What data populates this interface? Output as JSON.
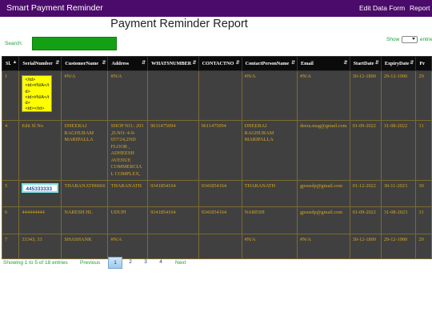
{
  "navbar": {
    "brand": "Smart Payment Reminder",
    "links": [
      "Edit Data Form",
      "Report"
    ]
  },
  "title": "Payment Reminder Report",
  "search": {
    "label": "Search:",
    "value": ""
  },
  "length": {
    "prefix": "Show",
    "suffix": "entries"
  },
  "colors": {
    "navbar": "#4b0b6b",
    "row_bg": "#404040",
    "row_text": "#d8a820",
    "header_bg": "#0b0b0b",
    "accent_green": "#1e9e3a",
    "search_box": "#14a014"
  },
  "table": {
    "headers": [
      "Sl.",
      "SerialNumber",
      "CustomerName",
      "Address",
      "WHATSNUMBER",
      "CONTACTNO",
      "ContactPersonName",
      "Email",
      "StartDate",
      "ExpiryDate",
      "Pr"
    ],
    "rows": [
      {
        "sl": "1",
        "serial_code": "</td>\n<td>#N/A</td>\n<td>#N/A</td>\n<td></td>\n<td></td>",
        "customer": "#N/A",
        "address": "#N/A",
        "whats": "",
        "contact": "",
        "person": "#N/A",
        "email": "#N/A",
        "start": "30-12-1899",
        "expiry": "29-12-1900",
        "pr": "29"
      },
      {
        "sl": "4",
        "serial": "Edit Sl No",
        "customer": "DHEERAJ RAGHURAM MARIPALLA",
        "address": "SHOP NO.: 203 ,D.NO: 4-9-657/24,2ND FLOOR , ADHEESH AVENUE COMMERCIAL COMPLEX,",
        "whats": "9611475094",
        "contact": "9611475094",
        "person": "DHEERAJ RAGHURAM MARIPALLA",
        "email": "deera.mag@gmail.com",
        "start": "01-09-2022",
        "expiry": "31-08-2022",
        "pr": "31"
      },
      {
        "sl": "5",
        "serial_input": "445333333",
        "customer": "THARANATH6666",
        "address": "THARANATH",
        "whats": "9341854164",
        "contact": "9341854164",
        "person": "THARANATH",
        "email": "gpsnsdp@gmail.com",
        "start": "01-12-2022",
        "expiry": "30-11-2023",
        "pr": "30"
      },
      {
        "sl": "6",
        "serial": "444444444",
        "customer": "NARESH HL",
        "address": "UDUPI",
        "whats": "9341854164",
        "contact": "9341854164",
        "person": "NARESH",
        "email": "gpsnsdp@gmail.com",
        "start": "01-09-2022",
        "expiry": "31-08-2023",
        "pr": "31"
      },
      {
        "sl": "7",
        "serial": "33343, 33",
        "customer": "SHASHANK",
        "address": "#N/A",
        "whats": "",
        "contact": "",
        "person": "#N/A",
        "email": "#N/A",
        "start": "30-12-1899",
        "expiry": "29-12-1900",
        "pr": "29"
      }
    ]
  },
  "footer": {
    "info": "Showing 1 to 5 of 18 entries",
    "previous": "Previous",
    "pages": [
      "1",
      "2",
      "3",
      "4"
    ],
    "next": "Next",
    "current_page": "1"
  }
}
